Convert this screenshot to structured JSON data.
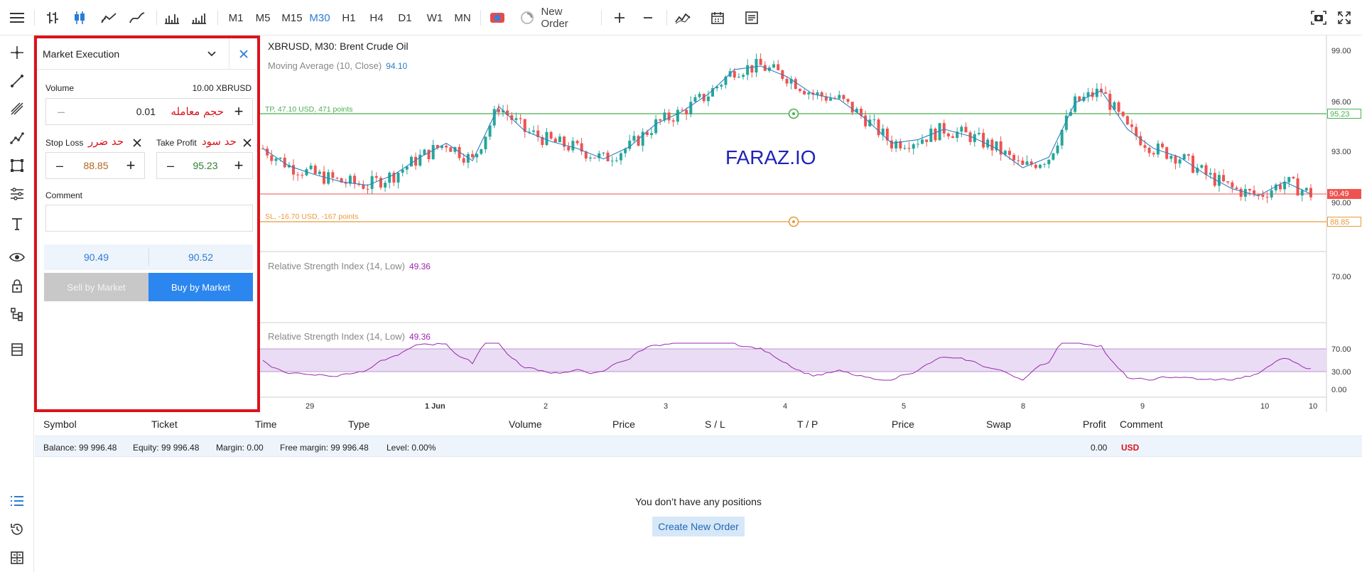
{
  "toolbar": {
    "timeframes": [
      "M1",
      "M5",
      "M15",
      "M30",
      "H1",
      "H4",
      "D1",
      "W1",
      "MN"
    ],
    "active_timeframe": "M30",
    "new_order_label": "New Order"
  },
  "panel": {
    "title": "Market Execution",
    "volume_label": "Volume",
    "volume_max": "10.00 XBRUSD",
    "volume_value": "0.01",
    "volume_persian": "حجم معامله",
    "stop_loss_label": "Stop Loss",
    "stop_loss_persian": "حد ضرر",
    "stop_loss_value": "88.85",
    "take_profit_label": "Take Profit",
    "take_profit_persian": "حد سود",
    "take_profit_value": "95.23",
    "comment_label": "Comment",
    "comment_value": "",
    "bid": "90.49",
    "ask": "90.52",
    "sell_label": "Sell by Market",
    "buy_label": "Buy by Market"
  },
  "chart": {
    "title": "XBRUSD, M30: Brent Crude Oil",
    "ma_label": "Moving Average (10, Close)",
    "ma_value": "94.10",
    "watermark": "FARAZ.IO",
    "tp_line_label": "TP, 47.10 USD, 471 points",
    "sl_line_label": "SL, -16.70 USD, -167 points",
    "rsi_label_1": "Relative Strength Index (14, Low)",
    "rsi_value_1": "49.36",
    "rsi_label_2": "Relative Strength Index (14, Low)",
    "rsi_value_2": "49.36",
    "price_ticks": [
      "99.00",
      "96.00",
      "93.00",
      "90.00"
    ],
    "rsi1_tick": "70.00",
    "rsi2_ticks": [
      "70.00",
      "30.00",
      "0.00"
    ],
    "tag_tp": "95.23",
    "tag_current": "90.49",
    "tag_sl": "88.85",
    "x_ticks": [
      "29",
      "1 Jun",
      "2",
      "3",
      "4",
      "5",
      "8",
      "9",
      "10",
      "10"
    ],
    "colors": {
      "up": "#26a69a",
      "down": "#ef5350",
      "ma": "#2f7fc1",
      "tp": "#4caf50",
      "sl": "#e89a3c",
      "current": "#ef5350",
      "rsi": "#9c27b0"
    }
  },
  "chart_data": {
    "type": "line",
    "title": "XBRUSD, M30: Brent Crude Oil",
    "ylim": [
      87.5,
      99.5
    ],
    "x_ticks": [
      "29",
      "1 Jun",
      "2",
      "3",
      "4",
      "5",
      "8",
      "9",
      "10",
      "10"
    ],
    "series": [
      {
        "name": "Moving Average (10, Close)",
        "x": [
          0,
          6,
          12,
          18,
          24,
          30,
          36,
          42,
          48,
          54,
          60,
          66,
          72,
          78,
          84,
          90,
          96,
          102,
          108,
          114,
          120,
          126,
          132,
          138,
          144,
          150,
          156,
          162,
          168,
          174,
          180,
          186,
          192,
          198,
          204,
          210,
          216,
          222,
          228,
          234,
          240
        ],
        "values": [
          93.3,
          92.3,
          91.8,
          91.4,
          91.2,
          91.8,
          92.8,
          93.6,
          92.6,
          95.7,
          94.3,
          93.7,
          93.3,
          92.7,
          93.4,
          94.7,
          95.4,
          96.4,
          97.8,
          98.0,
          97.4,
          96.4,
          96.1,
          95.0,
          93.6,
          93.8,
          94.4,
          94.0,
          93.3,
          92.2,
          92.8,
          95.9,
          96.6,
          94.4,
          93.3,
          92.8,
          91.8,
          91.0,
          90.6,
          91.4,
          90.7
        ]
      }
    ],
    "levels": {
      "take_profit": 95.23,
      "current": 90.49,
      "stop_loss": 88.85
    },
    "rsi_value": 49.36
  },
  "positions": {
    "columns": [
      "Symbol",
      "Ticket",
      "Time",
      "Type",
      "Volume",
      "Price",
      "S / L",
      "T / P",
      "Price",
      "Swap",
      "Profit",
      "Comment"
    ],
    "balance": "Balance: 99 996.48",
    "equity": "Equity: 99 996.48",
    "margin": "Margin: 0.00",
    "free_margin": "Free margin: 99 996.48",
    "level": "Level: 0.00%",
    "profit": "0.00",
    "currency": "USD",
    "empty_message": "You don’t have any positions",
    "create_label": "Create New Order"
  }
}
